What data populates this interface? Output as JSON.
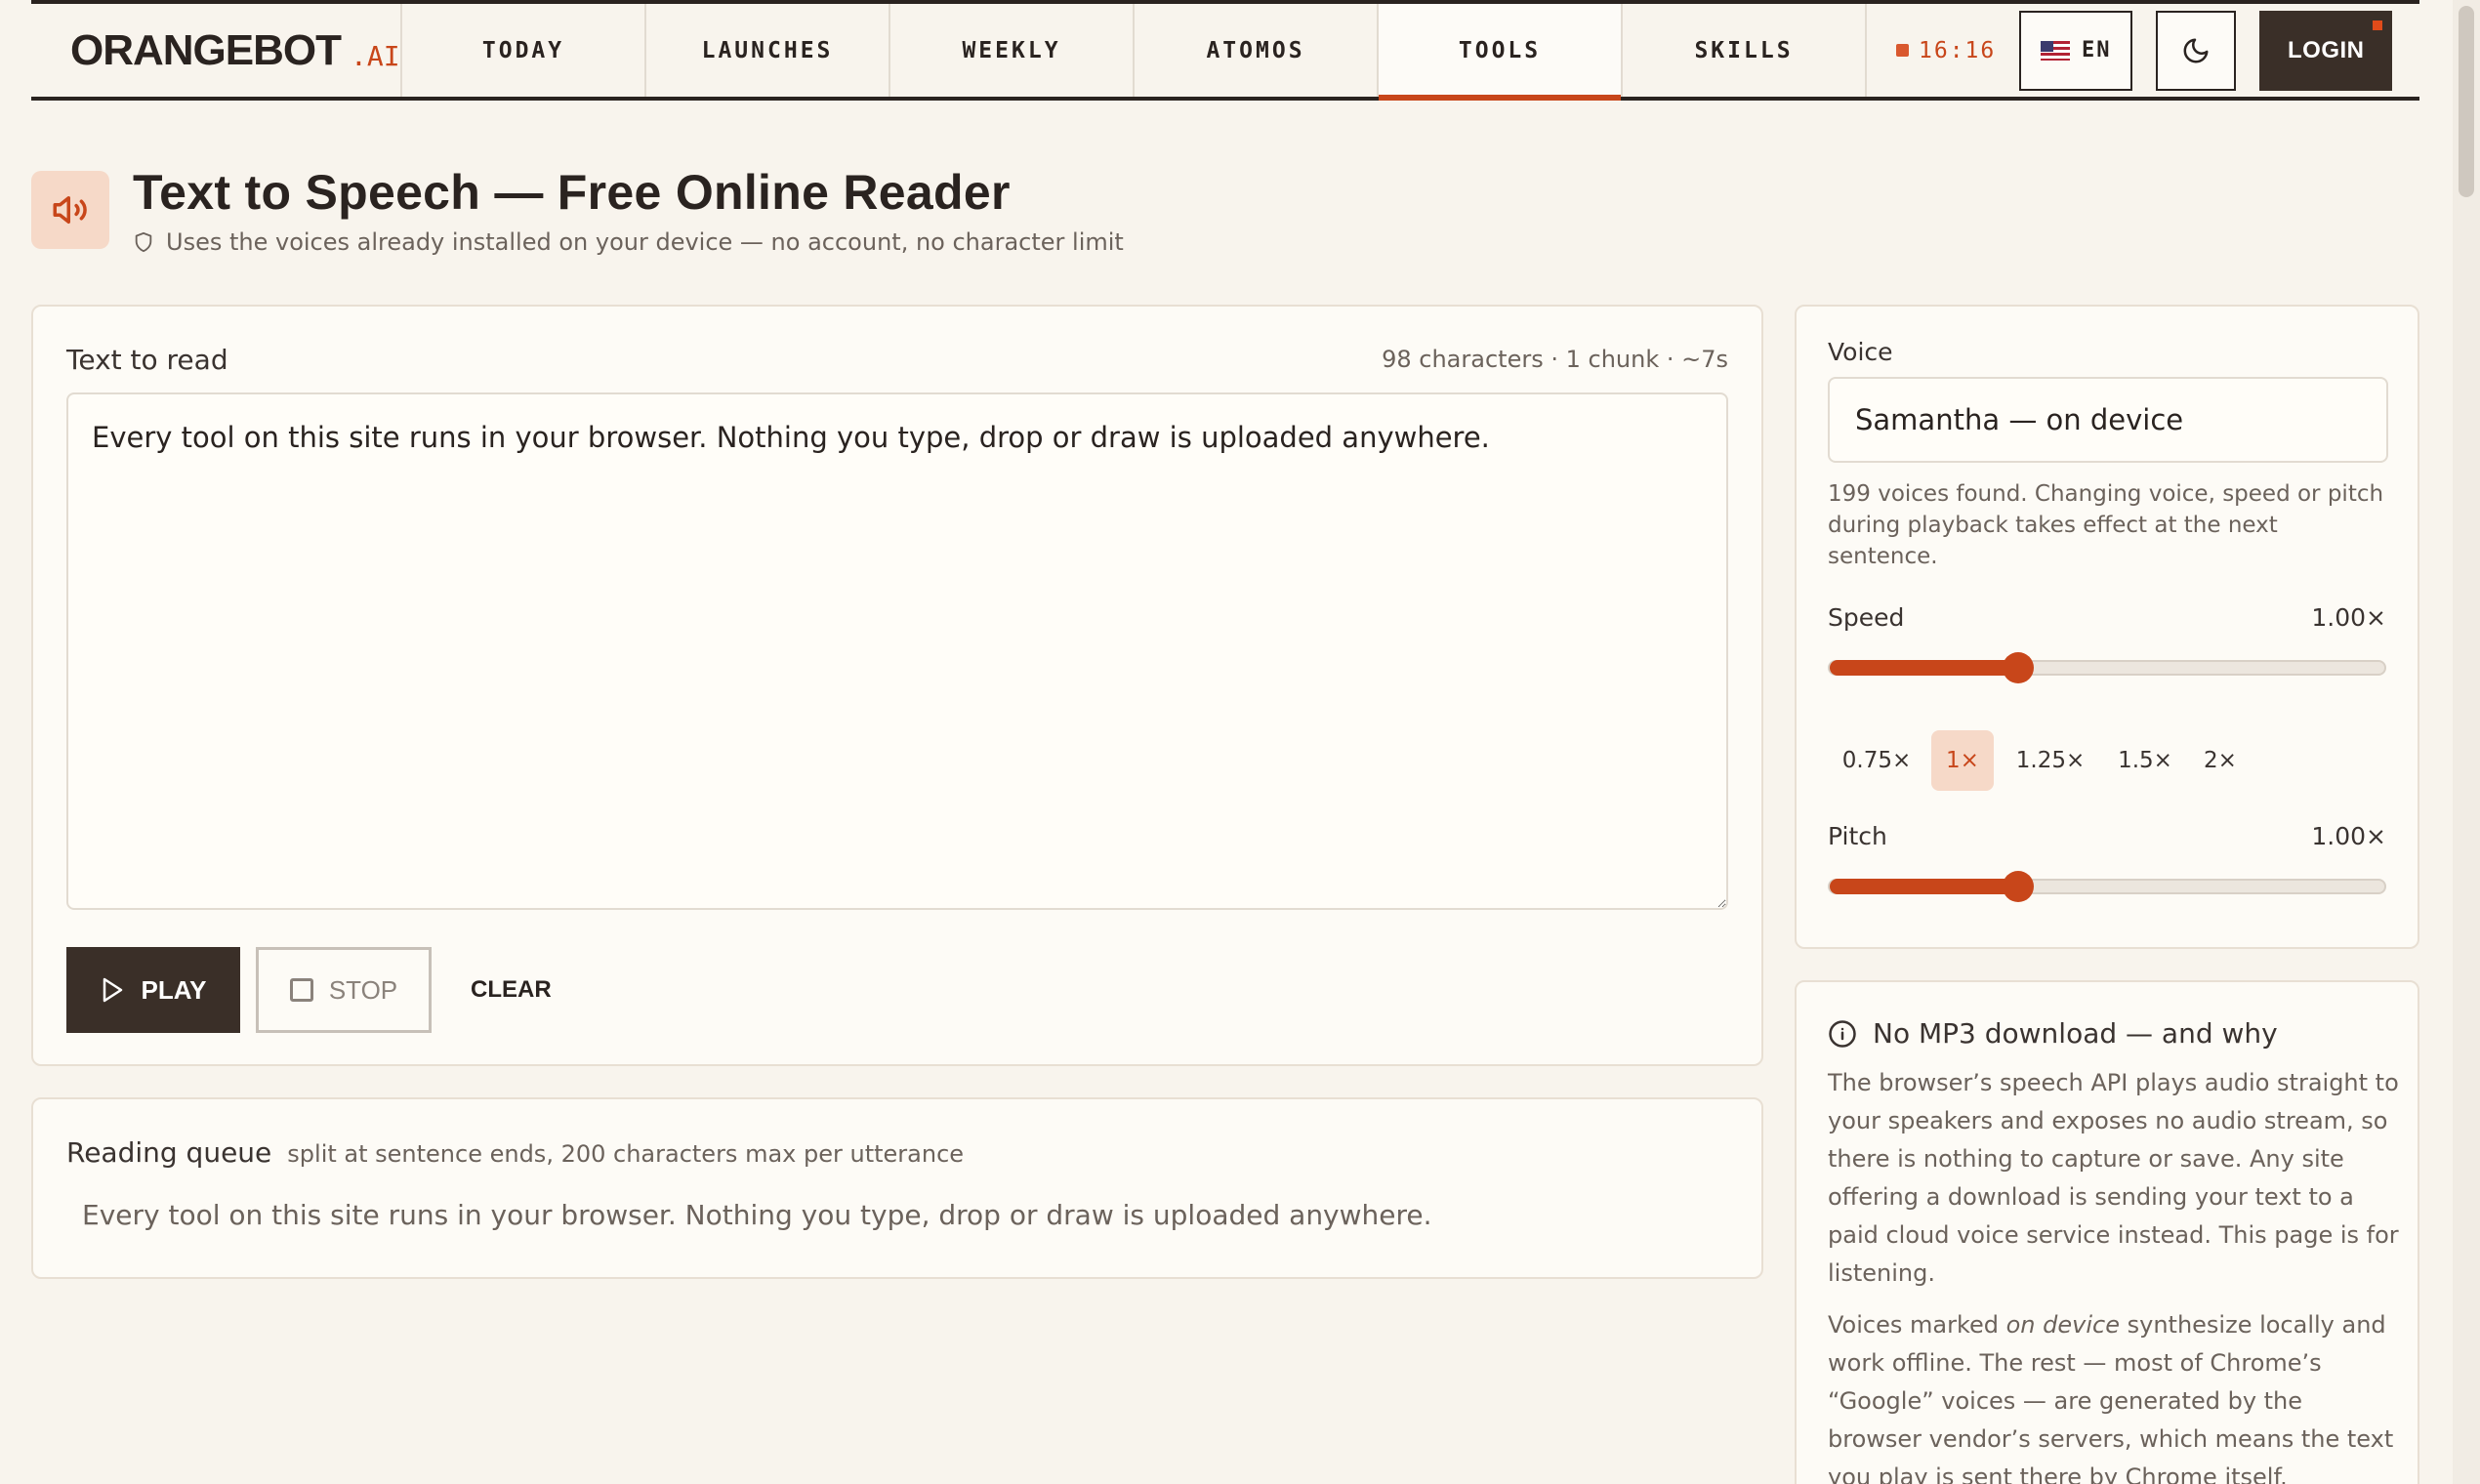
{
  "nav": {
    "logo_main": "ORANGEBOT",
    "logo_suffix": ".AI",
    "tabs": [
      {
        "label": "TODAY"
      },
      {
        "label": "LAUNCHES"
      },
      {
        "label": "WEEKLY"
      },
      {
        "label": "ATOMOS"
      },
      {
        "label": "TOOLS",
        "active": true
      },
      {
        "label": "SKILLS"
      }
    ],
    "clock": "16:16",
    "language": "EN",
    "login_label": "LOGIN"
  },
  "header": {
    "title": "Text to Speech — Free Online Reader",
    "subtitle": "Uses the voices already installed on your device — no account, no character limit"
  },
  "editor": {
    "label": "Text to read",
    "stats": "98 characters · 1 chunk · ~7s",
    "text": "Every tool on this site runs in your browser. Nothing you type, drop or draw is uploaded anywhere.",
    "play_label": "PLAY",
    "stop_label": "STOP",
    "clear_label": "CLEAR"
  },
  "queue": {
    "title": "Reading queue",
    "note": "split at sentence ends, 200 characters max per utterance",
    "items": [
      "Every tool on this site runs in your browser. Nothing you type, drop or draw is uploaded anywhere."
    ]
  },
  "settings": {
    "voice_label": "Voice",
    "voice_value": "Samantha — on device",
    "voice_help": "199 voices found. Changing voice, speed or pitch during playback takes effect at the next sentence.",
    "speed_label": "Speed",
    "speed_value": "1.00×",
    "speed_fraction": 0.34,
    "presets": [
      "0.75×",
      "1×",
      "1.25×",
      "1.5×",
      "2×"
    ],
    "active_preset": "1×",
    "pitch_label": "Pitch",
    "pitch_value": "1.00×",
    "pitch_fraction": 0.34
  },
  "info": {
    "title": "No MP3 download — and why",
    "para1": "The browser’s speech API plays audio straight to your speakers and exposes no audio stream, so there is nothing to capture or save. Any site offering a download is sending your text to a paid cloud voice service instead. This page is for listening.",
    "para2_pre": "Voices marked ",
    "para2_em": "on device",
    "para2_post": " synthesize locally and work offline. The rest — most of Chrome’s “Google” voices — are generated by the browser vendor’s servers, which means the text you play is sent there by Chrome itself."
  },
  "colors": {
    "accent": "#c8461a",
    "background": "#f8f4ed",
    "dark": "#3a2f28"
  }
}
